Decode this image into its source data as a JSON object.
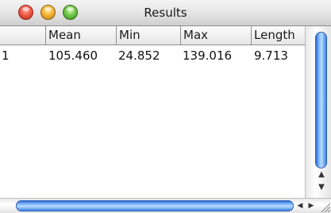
{
  "window": {
    "title": "Results"
  },
  "table": {
    "columns": [
      "",
      "Mean",
      "Min",
      "Max",
      "Length"
    ],
    "rows": [
      {
        "index": "1",
        "mean": "105.460",
        "min": "24.852",
        "max": "139.016",
        "length": "9.713"
      }
    ]
  },
  "scrollbars": {
    "up_arrow": "▲",
    "down_arrow": "▼",
    "left_arrow": "◀",
    "right_arrow": "▶"
  },
  "colors": {
    "accent": "#4a90e6",
    "close": "#f25a48",
    "minimize": "#f6b537",
    "zoom": "#72c84a"
  }
}
